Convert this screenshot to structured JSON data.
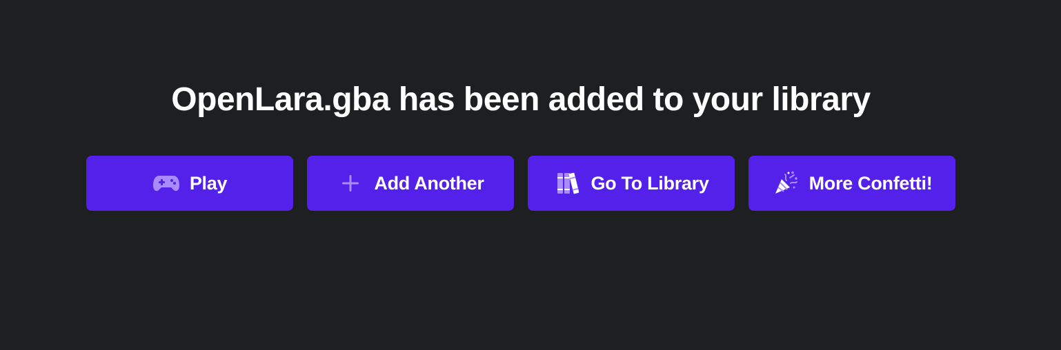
{
  "message": {
    "title": "OpenLara.gba has been added to your library"
  },
  "actions": {
    "play": {
      "label": "Play",
      "icon": "gamepad-icon"
    },
    "add_another": {
      "label": "Add Another",
      "icon": "plus-icon"
    },
    "go_to_library": {
      "label": "Go To Library",
      "icon": "books-icon"
    },
    "more_confetti": {
      "label": "More Confetti!",
      "icon": "party-popper-icon"
    }
  },
  "colors": {
    "background": "#1e1f21",
    "button": "#5421ea",
    "icon": "#a98bff",
    "text": "#ffffff"
  }
}
